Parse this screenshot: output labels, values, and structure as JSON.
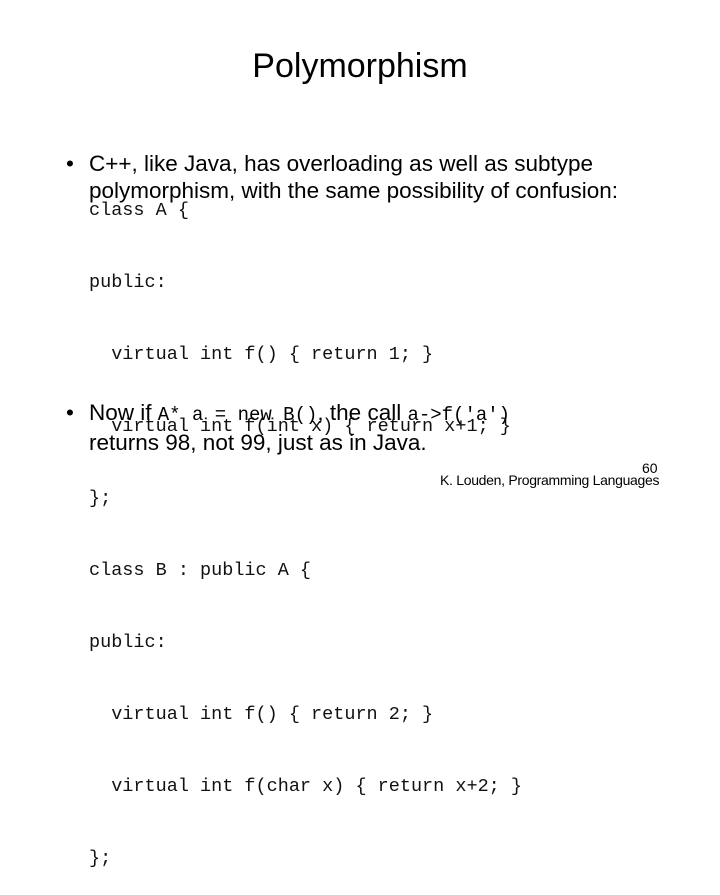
{
  "slide": {
    "title": "Polymorphism",
    "bullet_glyph": "•",
    "bullet1": {
      "line1": "C++, like Java, has overloading as well as subtype",
      "line2": "polymorphism, with the same possibility of confusion:"
    },
    "code_lines": [
      "class A {",
      "public:",
      "  virtual int f() { return 1; }",
      "  virtual int f(int x) { return x+1; }",
      "};",
      "class B : public A {",
      "public:",
      "  virtual int f() { return 2; }",
      "  virtual int f(char x) { return x+2; }",
      "};"
    ],
    "bullet2": {
      "prefix": "Now if ",
      "code1": "A* a = new B()",
      "middle": ", the call ",
      "code2": "a->f('a')",
      "line2": "returns 98, not 99, just as in Java."
    },
    "page_number": "60",
    "footer": "K. Louden, Programming Languages"
  }
}
